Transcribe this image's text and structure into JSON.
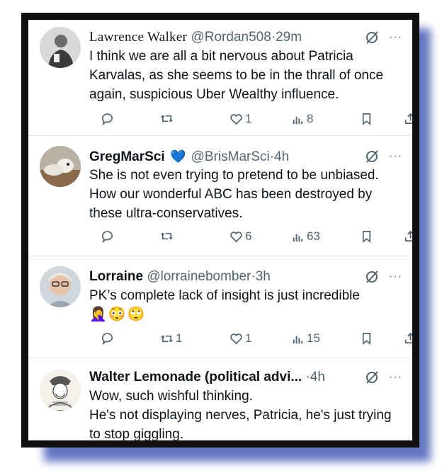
{
  "tweets": [
    {
      "name": "Lawrence Walker",
      "handle": "@Rordan508",
      "sep": "·",
      "time": "29m",
      "text": "I think we are all a bit nervous about Patricia Karvalas, as she seems to be in the thrall of once again, suspicious Uber Wealthy influence.",
      "replies": "",
      "retweets": "",
      "likes": "1",
      "views": "8"
    },
    {
      "name": "GregMarSci",
      "badge": "💙",
      "handle": "@BrisMarSci",
      "sep": "·",
      "time": "4h",
      "text": "She is not even trying to pretend to be unbiased. How our wonderful ABC has been destroyed by these ultra-conservatives.",
      "replies": "",
      "retweets": "",
      "likes": "6",
      "views": "63"
    },
    {
      "name": "Lorraine",
      "handle": "@lorrainebomber",
      "sep": "·",
      "time": "3h",
      "text": "PK’s complete lack of insight is just incredible",
      "emoji": "🤦‍♀️😳🙄",
      "replies": "",
      "retweets": "1",
      "likes": "1",
      "views": "15"
    },
    {
      "name": "Walter Lemonade (political advi...",
      "handle": "",
      "sep": "·",
      "time": "4h",
      "text_lines": [
        "Wow, such wishful thinking.",
        "He's not displaying nerves, Patricia, he's just trying to stop giggling."
      ]
    }
  ],
  "icons": {
    "grok": "grok-slash-icon",
    "more": "···",
    "reply": "reply-icon",
    "retweet": "retweet-icon",
    "like": "heart-icon",
    "views": "views-icon",
    "bookmark": "bookmark-icon",
    "share": "share-icon"
  },
  "colors": {
    "frame": "#111111",
    "shadow": "#4a5fb8",
    "secondary_text": "#536471",
    "heart_badge": "#1d6fe8"
  }
}
